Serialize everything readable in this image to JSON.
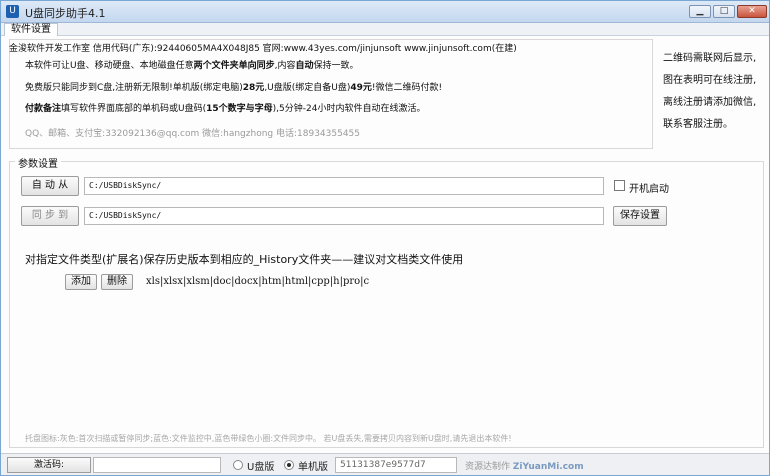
{
  "window": {
    "title": "U盘同步助手4.1",
    "icon": "u-disk-app-icon",
    "buttons": {
      "minimize": "▁",
      "maximize": "□",
      "close": "✕"
    }
  },
  "tabs": [
    {
      "label": "软件设置"
    }
  ],
  "info": {
    "line1": "金浚软件开发工作室 信用代码(广东):92440605MA4X048J85 官网:www.43yes.com/jinjunsoft   www.jinjunsoft.com(在建)",
    "line2_pre": "本软件可让U盘、移动硬盘、本地磁盘任意",
    "line2_bold": "两个文件夹单向同步",
    "line2_mid": ",内容",
    "line2_bold2": "自动",
    "line2_post": "保持一致。",
    "line3_pre": "免费版只能同步到C盘,注册新无限制!单机版(绑定电脑)",
    "line3_price1": "28元",
    "line3_mid": ",U盘版(绑定自备U盘)",
    "line3_price2": "49元",
    "line3_post": "!微信二维码付款!",
    "line4_bold": "付款备注",
    "line4_mid": "填写软件界面底部的单机码或U盘码(",
    "line4_bold2": "15个数字与字母",
    "line4_post": "),5分钟-24小时内软件自动在线激活。",
    "contact": "QQ、邮箱、支付宝:332092136@qq.com      微信:hangzhong      电话:18934355455"
  },
  "side_notes": [
    "二维码需联网后显示,",
    "图在表明可在线注册,",
    "离线注册请添加微信,",
    "联系客服注册。"
  ],
  "params": {
    "group_label": "参数设置",
    "from_button": "自 动 从",
    "from_path": "C:/USBDiskSync/",
    "to_button": "同 步 到",
    "to_path": "C:/USBDiskSync/",
    "autostart_label": "开机启动",
    "autostart_checked": false,
    "save_button": "保存设置",
    "history_text": "对指定文件类型(扩展名)保存历史版本到相应的_History文件夹——建议对文档类文件使用",
    "add_button": "添加",
    "delete_button": "删除",
    "extensions": "xls|xlsx|xlsm|doc|docx|htm|html|cpp|h|pro|c"
  },
  "footer_note": "托盘图标:灰色:首次扫描或暂停同步;蓝色:文件监控中,蓝色带绿色小圈:文件同步中。   若U盘丢失,需要拷贝内容到新U盘时,请先退出本软件!",
  "status": {
    "activate_button": "激活码:",
    "activation_code": "",
    "radio_usb_label": "U盘版",
    "radio_pc_label": "单机版",
    "selected_mode": "单机版",
    "machine_code": "51131387e9577d7",
    "credit": "资源达制作",
    "watermark": "ZiYuanMi.com"
  }
}
